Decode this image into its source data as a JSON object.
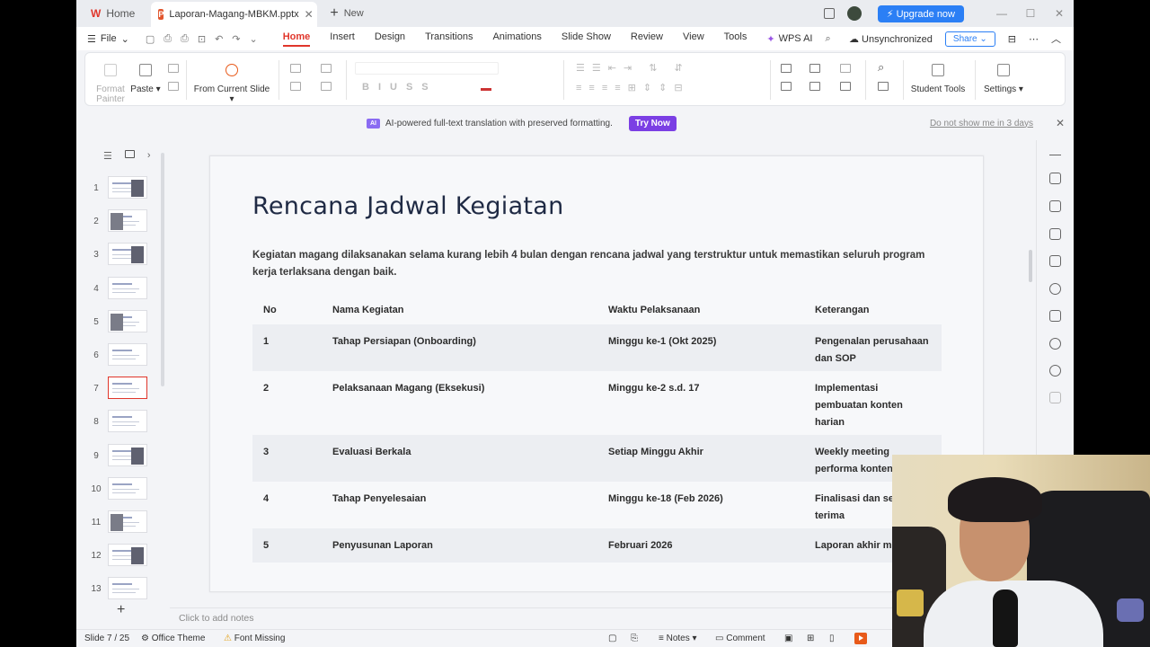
{
  "titlebar": {
    "home_label": "Home",
    "doc_tab": "Laporan-Magang-MBKM.pptx",
    "new_label": "New",
    "upgrade_label": "Upgrade now"
  },
  "menubar": {
    "file_label": "File",
    "items": [
      "Home",
      "Insert",
      "Design",
      "Transitions",
      "Animations",
      "Slide Show",
      "Review",
      "View",
      "Tools"
    ],
    "wps_ai": "WPS AI",
    "sync_status": "Unsynchronized",
    "share_label": "Share"
  },
  "ribbon": {
    "format_painter": "Format Painter",
    "paste": "Paste",
    "from_current_slide": "From Current Slide",
    "student_tools": "Student Tools",
    "settings": "Settings"
  },
  "notification": {
    "badge": "AI",
    "message": "AI-powered full-text translation with preserved formatting.",
    "try_now": "Try Now",
    "dismiss": "Do not show me in 3 days"
  },
  "thumbnails": {
    "numbers": [
      "1",
      "2",
      "3",
      "4",
      "5",
      "6",
      "7",
      "8",
      "9",
      "10",
      "11",
      "12",
      "13"
    ],
    "selected": "7"
  },
  "slide": {
    "title": "Rencana Jadwal Kegiatan",
    "description": "Kegiatan magang dilaksanakan selama kurang lebih 4 bulan dengan rencana jadwal yang terstruktur untuk memastikan seluruh program kerja terlaksana dengan baik.",
    "table": {
      "headers": [
        "No",
        "Nama Kegiatan",
        "Waktu Pelaksanaan",
        "Keterangan"
      ],
      "rows": [
        [
          "1",
          "Tahap Persiapan (Onboarding)",
          "Minggu ke-1 (Okt 2025)",
          "Pengenalan perusahaan dan SOP"
        ],
        [
          "2",
          "Pelaksanaan Magang (Eksekusi)",
          "Minggu ke-2 s.d. 17",
          "Implementasi pembuatan konten harian"
        ],
        [
          "3",
          "Evaluasi Berkala",
          "Setiap Minggu Akhir",
          "Weekly meeting performa konten"
        ],
        [
          "4",
          "Tahap Penyelesaian",
          "Minggu ke-18 (Feb 2026)",
          "Finalisasi dan serah terima"
        ],
        [
          "5",
          "Penyusunan Laporan",
          "Februari 2026",
          "Laporan akhir magang"
        ]
      ]
    }
  },
  "notes_placeholder": "Click to add notes",
  "status": {
    "slide_indicator": "Slide 7 / 25",
    "theme": "Office Theme",
    "font_missing": "Font Missing",
    "notes": "Notes",
    "comment": "Comment"
  }
}
